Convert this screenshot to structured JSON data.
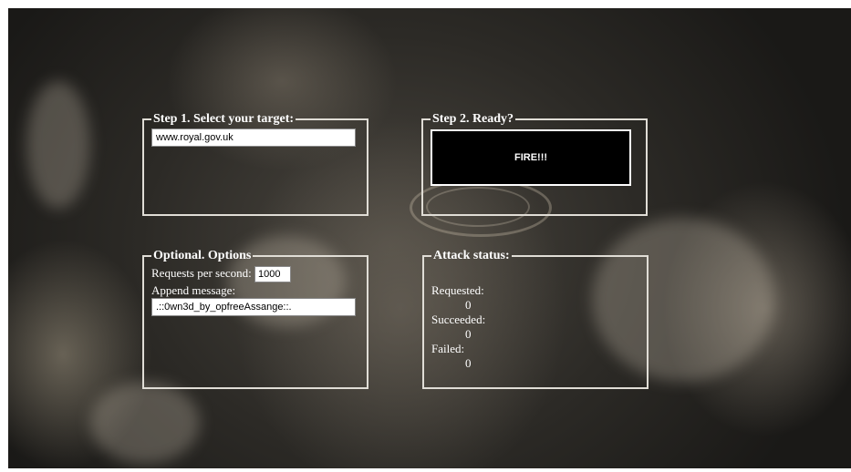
{
  "step1": {
    "legend": "Step 1. Select your target:",
    "target_value": "www.royal.gov.uk"
  },
  "step2": {
    "legend": "Step 2. Ready?",
    "fire_label": "FIRE!!!"
  },
  "options": {
    "legend": "Optional. Options",
    "rps_label": "Requests per second:",
    "rps_value": "1000",
    "append_label": "Append message:",
    "append_value": ".::0wn3d_by_opfreeAssange::."
  },
  "status": {
    "legend": "Attack status:",
    "requested_label": "Requested:",
    "requested_value": "0",
    "succeeded_label": "Succeeded:",
    "succeeded_value": "0",
    "failed_label": "Failed:",
    "failed_value": "0"
  },
  "colors": {
    "border": "#e0ddd6",
    "text": "#ffffff",
    "button_bg": "#000000"
  }
}
